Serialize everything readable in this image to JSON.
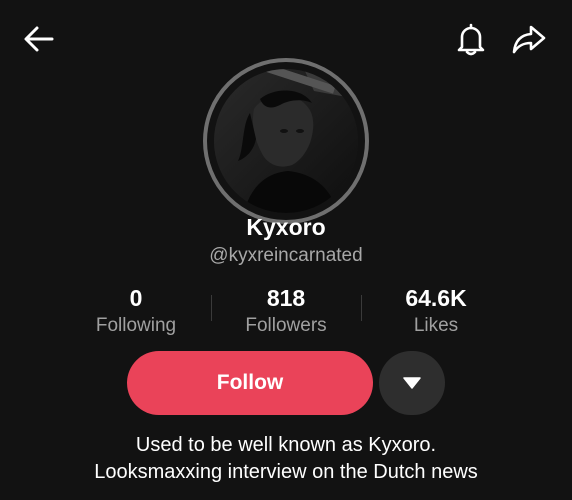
{
  "header": {
    "back_icon": "arrow-left-icon",
    "bell_icon": "bell-icon",
    "share_icon": "share-arrow-icon"
  },
  "profile": {
    "avatar_icon": "profile-photo",
    "name": "Kyxoro",
    "handle": "@kyxreincarnated"
  },
  "stats": [
    {
      "value": "0",
      "label": "Following"
    },
    {
      "value": "818",
      "label": "Followers"
    },
    {
      "value": "64.6K",
      "label": "Likes"
    }
  ],
  "actions": {
    "follow_label": "Follow",
    "more_icon": "caret-down-icon",
    "follow_color": "#ea4359"
  },
  "bio": {
    "line1": "Used to be well known as Kyxoro.",
    "line2": "Looksmaxxing interview on the Dutch news"
  }
}
